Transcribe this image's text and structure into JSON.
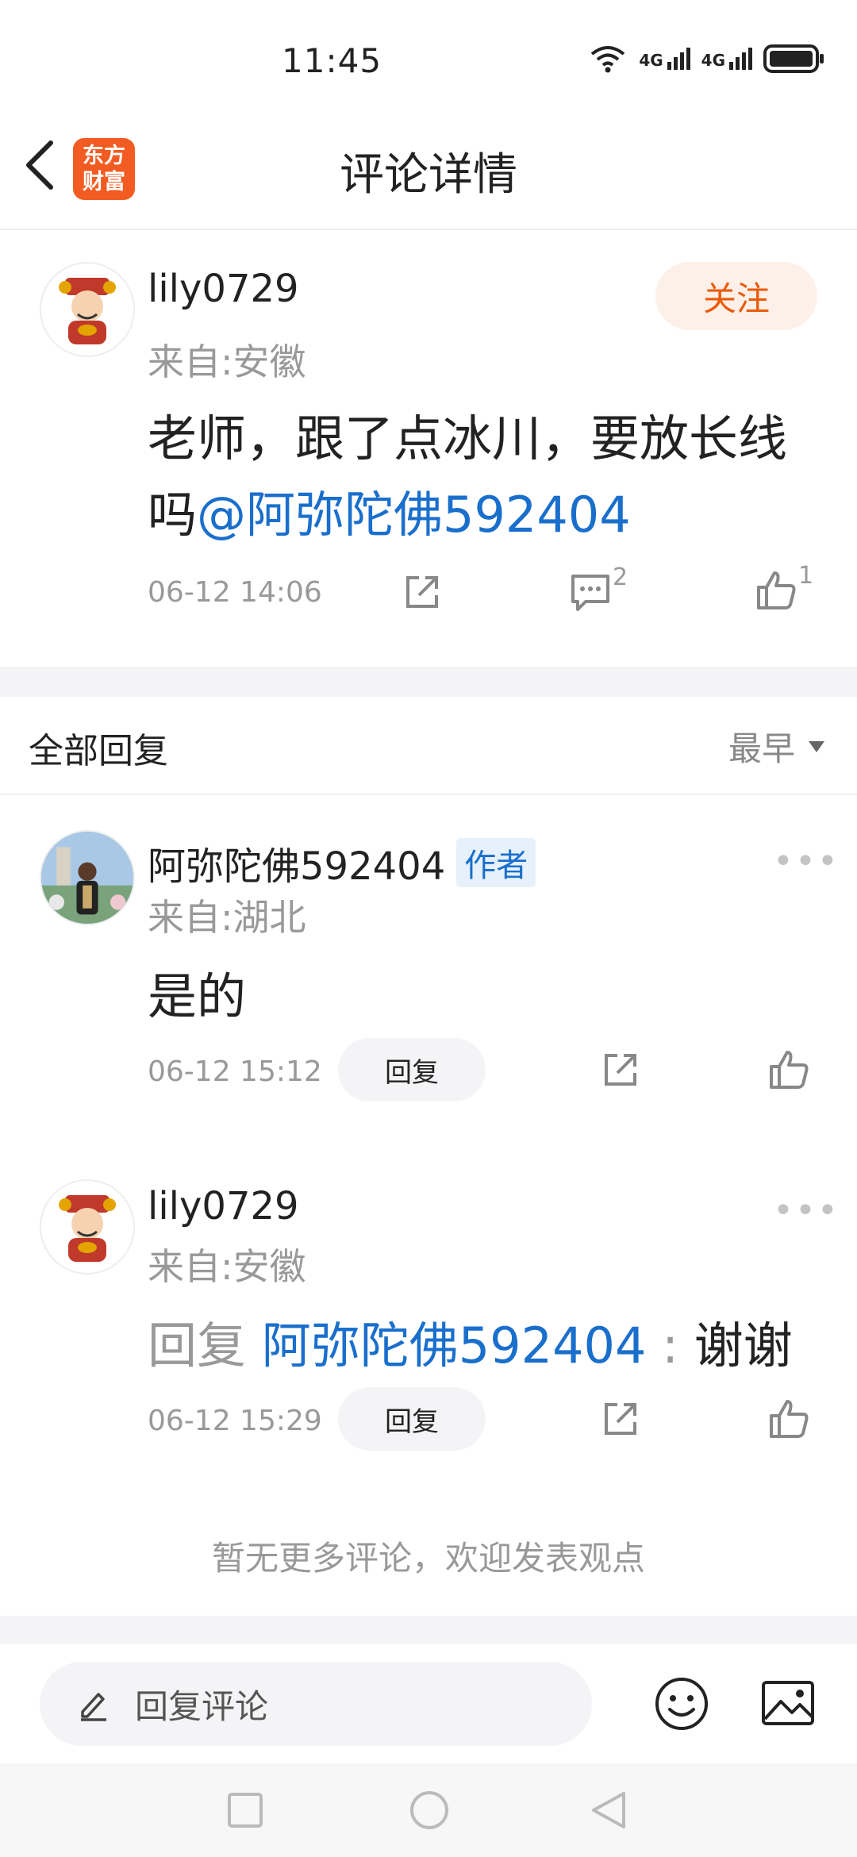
{
  "status_bar": {
    "time": "11:45",
    "signal_1": "4G",
    "signal_2": "4G"
  },
  "header": {
    "title": "评论详情",
    "logo_line1": "东方",
    "logo_line2": "财富"
  },
  "post": {
    "username": "lily0729",
    "location": "来自:安徽",
    "follow_label": "关注",
    "content_text": "老师，跟了点冰川，要放长线吗",
    "mention": "@阿弥陀佛592404",
    "time": "06-12 14:06",
    "comment_count": "2",
    "like_count": "1"
  },
  "replies_section": {
    "title": "全部回复",
    "sort_label": "最早"
  },
  "replies": [
    {
      "username": "阿弥陀佛592404",
      "badge": "作者",
      "location": "来自:湖北",
      "content": "是的",
      "time": "06-12 15:12",
      "reply_label": "回复"
    },
    {
      "username": "lily0729",
      "location": "来自:安徽",
      "reply_prefix": "回复",
      "reply_target": "阿弥陀佛592404",
      "reply_sep": ":",
      "content": "谢谢",
      "time": "06-12 15:29",
      "reply_label": "回复"
    }
  ],
  "footer_note": "暂无更多评论，欢迎发表观点",
  "input": {
    "placeholder": "回复评论"
  },
  "colors": {
    "accent": "#ea5b0c",
    "link": "#1a6fcc",
    "brand": "#f25b21"
  },
  "icons": [
    "back-icon",
    "share-icon",
    "comment-icon",
    "like-icon",
    "sort-down-icon",
    "more-icon",
    "pencil-icon",
    "emoji-icon",
    "image-icon"
  ]
}
